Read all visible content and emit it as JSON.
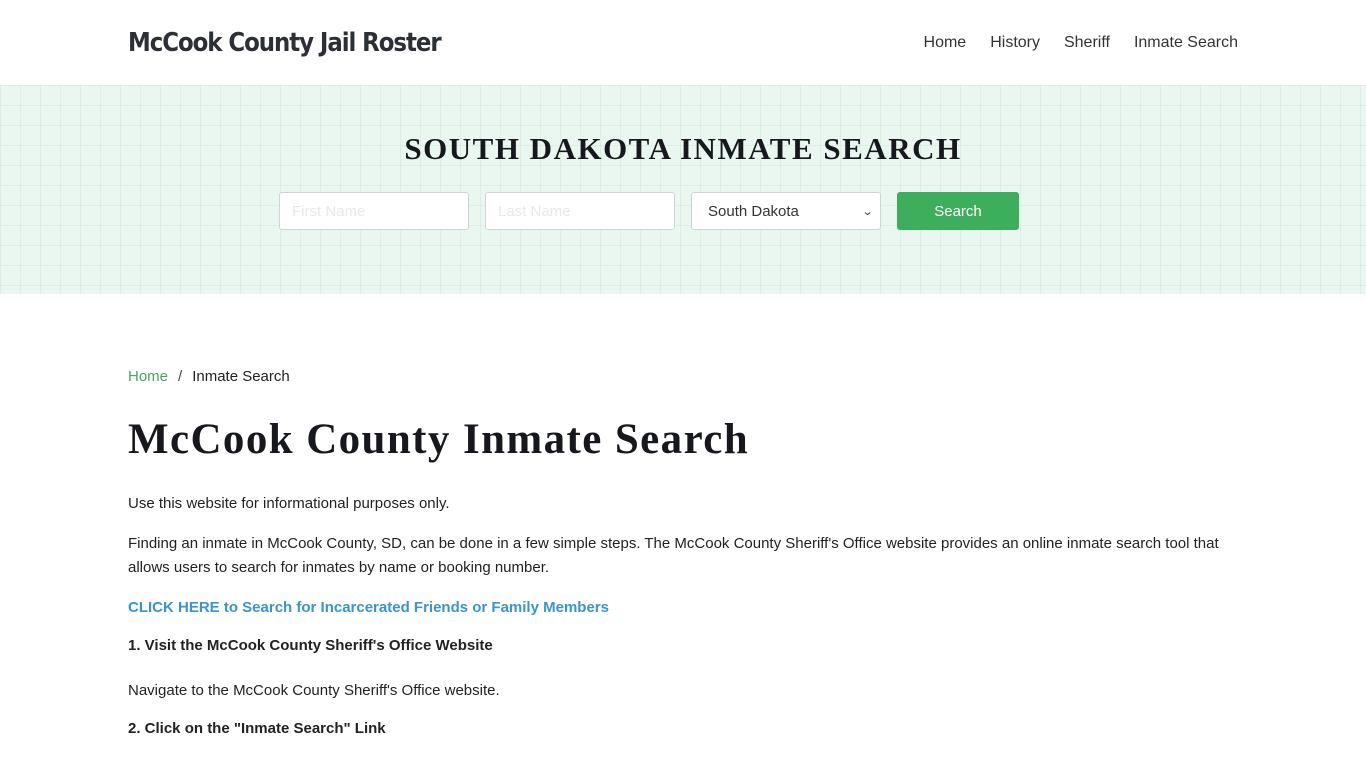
{
  "header": {
    "brand": "McCook County Jail Roster",
    "nav": [
      {
        "label": "Home"
      },
      {
        "label": "History"
      },
      {
        "label": "Sheriff"
      },
      {
        "label": "Inmate Search"
      }
    ]
  },
  "banner": {
    "title": "SOUTH DAKOTA INMATE SEARCH",
    "first_name_placeholder": "First Name",
    "last_name_placeholder": "Last Name",
    "state_selected": "South Dakota",
    "search_label": "Search"
  },
  "breadcrumb": {
    "home": "Home",
    "separator": "/",
    "current": "Inmate Search"
  },
  "page": {
    "title": "McCook County Inmate Search",
    "intro": "Use this website for informational purposes only.",
    "paragraph": "Finding an inmate in McCook County, SD, can be done in a few simple steps. The McCook County Sheriff's Office website provides an online inmate search tool that allows users to search for inmates by name or booking number.",
    "cta_link": "CLICK HERE to Search for Incarcerated Friends or Family Members",
    "steps": [
      {
        "heading": "1. Visit the McCook County Sheriff's Office Website",
        "text": "Navigate to the McCook County Sheriff's Office website."
      },
      {
        "heading": "2. Click on the \"Inmate Search\" Link"
      }
    ]
  },
  "colors": {
    "accent_green": "#3cae5c",
    "link_blue": "#3a95cf",
    "banner_bg": "#eaf7f0"
  }
}
